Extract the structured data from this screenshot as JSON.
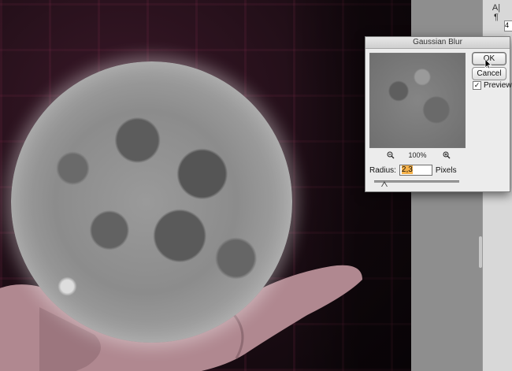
{
  "dialog": {
    "title": "Gaussian Blur",
    "ok_label": "OK",
    "cancel_label": "Cancel",
    "preview_label": "Preview",
    "preview_checked": true,
    "zoom_level": "100%",
    "radius_label": "Radius:",
    "radius_value": "2,3",
    "radius_unit": "Pixels"
  },
  "panel": {
    "tools": [
      {
        "icon": "text-tool-icon",
        "glyph": "A|"
      },
      {
        "icon": "paragraph-icon",
        "glyph": "¶"
      }
    ],
    "value_fragment": "4"
  },
  "colors": {
    "dialog_bg": "#ececec",
    "selection": "#f6b24a",
    "panel_bg": "#8e8e8e"
  }
}
